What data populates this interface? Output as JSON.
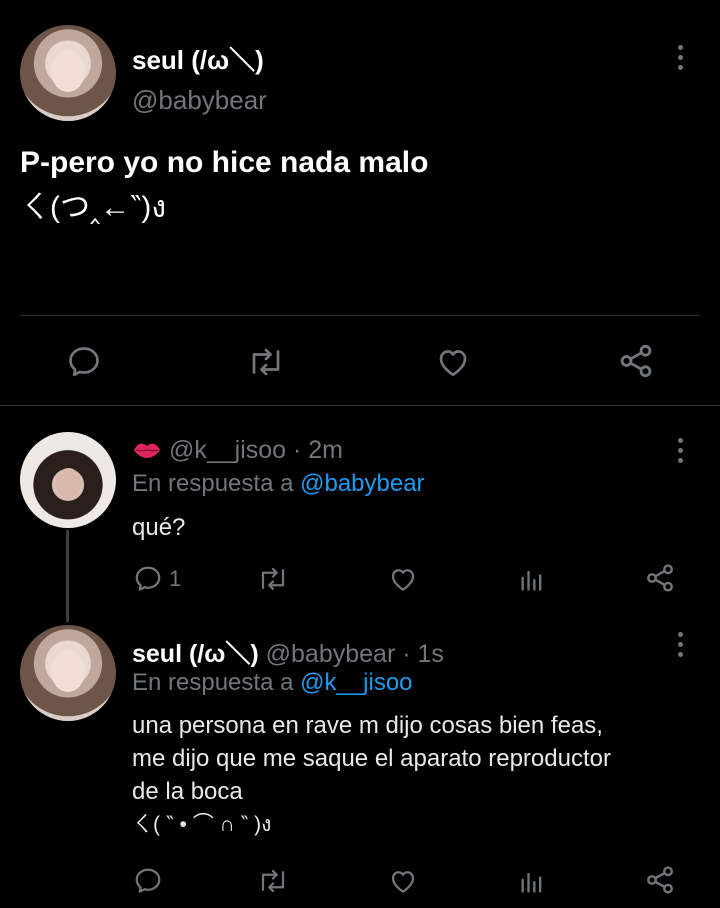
{
  "main_tweet": {
    "name": "seul (/ω＼)",
    "handle": "@babybear",
    "text_line1": "P-pero yo no hice nada malo",
    "text_line2": "ㄑ(つ‸←‶)ง"
  },
  "reply1": {
    "handle_time": "@k__jisoo · 2m",
    "reply_prefix": "En respuesta a",
    "reply_to": "@babybear",
    "text": "qué?",
    "reply_count": "1"
  },
  "reply2": {
    "name": "seul (/ω＼)",
    "handle_time": "@babybear · 1s",
    "reply_prefix": "En respuesta a",
    "reply_to": "@k__jisoo",
    "text_line1": "una persona en rave m dijo cosas bien feas,",
    "text_line2": "me dijo que me saque el aparato reproductor",
    "text_line3": "de la boca",
    "text_line4": "ㄑ( ‶ •  ⌒ ∩ ‶ )ง"
  },
  "icons": {
    "reply": "reply-icon",
    "retweet": "retweet-icon",
    "like": "heart-icon",
    "share": "share-icon",
    "analytics": "analytics-icon",
    "more": "more-vertical-icon",
    "lips": "lips-emoji-icon"
  },
  "colors": {
    "background": "#000000",
    "text": "#e7e9ea",
    "muted": "#71767b",
    "link": "#1d9bf0",
    "emoji": "#e0245e"
  }
}
